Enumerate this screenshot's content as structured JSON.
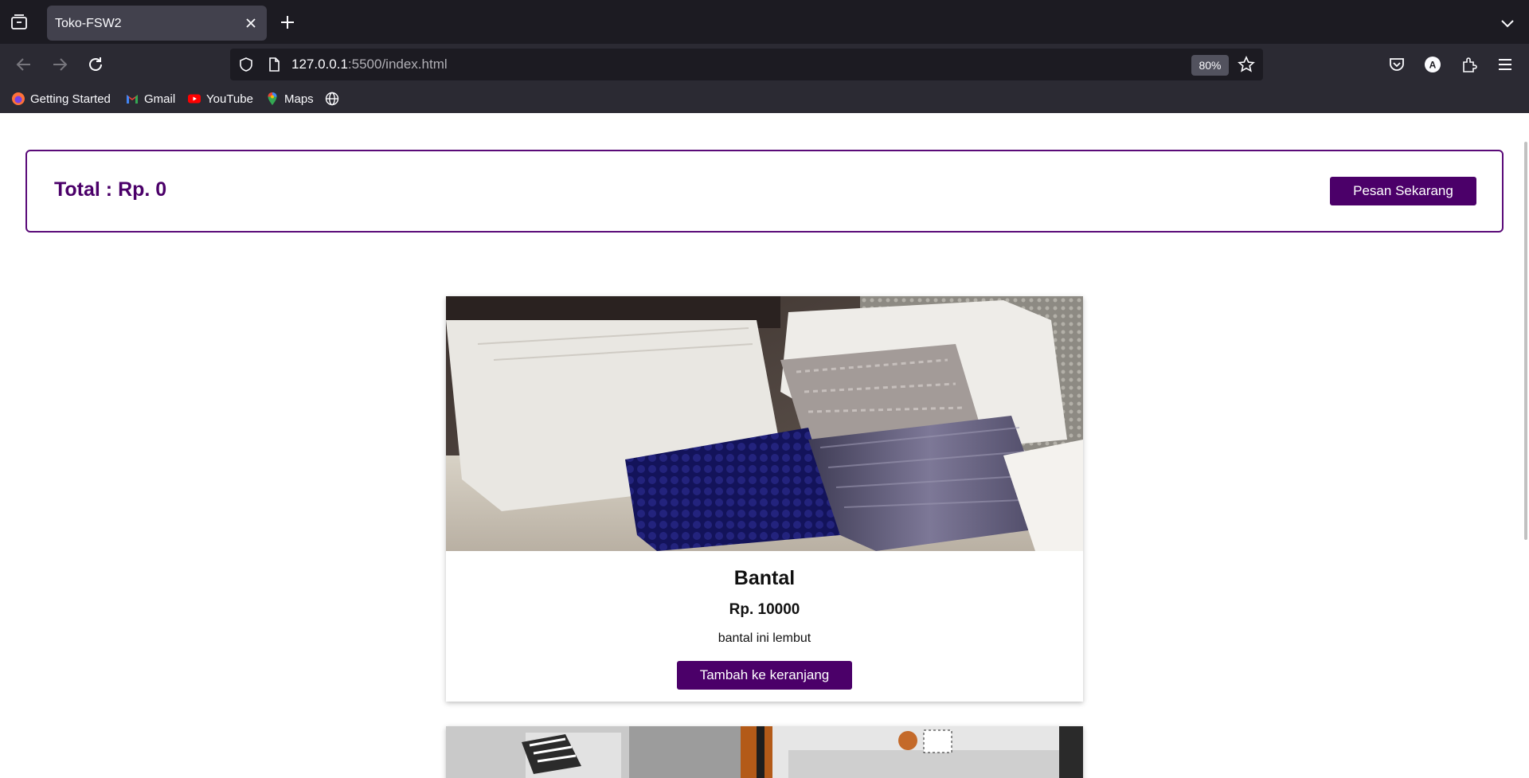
{
  "browser": {
    "tab_title": "Toko-FSW2",
    "url_host": "127.0.0.1",
    "url_rest": ":5500/index.html",
    "zoom": "80%",
    "bookmarks": [
      {
        "label": "Getting Started",
        "icon": "firefox-icon"
      },
      {
        "label": "Gmail",
        "icon": "gmail-icon"
      },
      {
        "label": "YouTube",
        "icon": "youtube-icon"
      },
      {
        "label": "Maps",
        "icon": "maps-icon"
      }
    ]
  },
  "cart": {
    "total_label": "Total : Rp. 0",
    "order_button": "Pesan Sekarang"
  },
  "products": [
    {
      "name": "Bantal",
      "price": "Rp. 10000",
      "description": "bantal ini lembut",
      "button": "Tambah ke keranjang",
      "image": "pillows-photo"
    },
    {
      "image": "sofa-photo"
    }
  ],
  "colors": {
    "accent": "#4b0069",
    "chrome_dark": "#1c1b22",
    "chrome": "#2b2a33"
  }
}
